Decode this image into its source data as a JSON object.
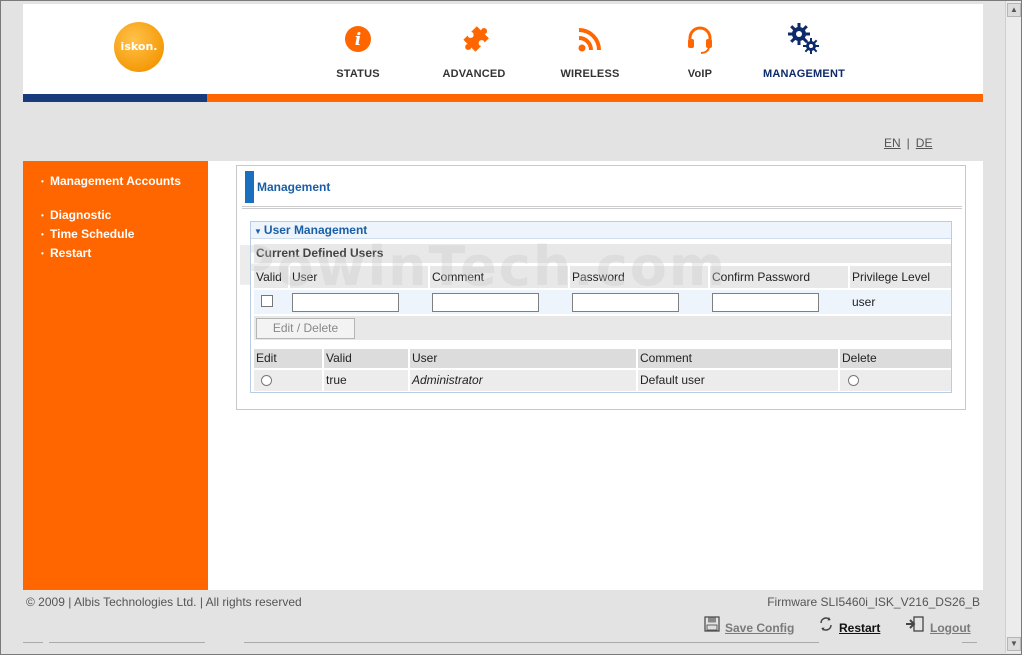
{
  "header": {
    "logo_text": "iskon.",
    "nav": [
      {
        "label": "STATUS",
        "icon": "info-icon"
      },
      {
        "label": "ADVANCED",
        "icon": "puzzle-icon"
      },
      {
        "label": "WIRELESS",
        "icon": "wireless-icon"
      },
      {
        "label": "VoIP",
        "icon": "headset-icon"
      },
      {
        "label": "MANAGEMENT",
        "icon": "gears-icon",
        "active": true
      }
    ]
  },
  "language": {
    "en": "EN",
    "sep": "|",
    "de": "DE"
  },
  "sidebar": {
    "items": [
      {
        "label": "Management Accounts"
      },
      {
        "label": "Diagnostic"
      },
      {
        "label": "Time Schedule"
      },
      {
        "label": "Restart"
      }
    ]
  },
  "panel": {
    "title": "Management",
    "section_title": "User Management",
    "current_users_label": "Current Defined Users",
    "form_headers": [
      "Valid",
      "User",
      "Comment",
      "Password",
      "Confirm Password",
      "Privilege Level"
    ],
    "form_row": {
      "valid_checked": false,
      "user": "",
      "comment": "",
      "password": "",
      "confirm_password": "",
      "privilege_level": "user"
    },
    "edit_delete_label": "Edit / Delete",
    "table_headers": [
      "Edit",
      "Valid",
      "User",
      "Comment",
      "Delete"
    ],
    "table_rows": [
      {
        "valid": "true",
        "user": "Administrator",
        "comment": "Default user"
      }
    ]
  },
  "footer": {
    "copyright": "© 2009 | Albis Technologies Ltd. | All rights reserved",
    "firmware": "Firmware SLI5460i_ISK_V216_DS26_B"
  },
  "actions": {
    "save_config": "Save Config",
    "restart": "Restart",
    "logout": "Logout"
  },
  "watermark": "PowinTech.com",
  "colors": {
    "orange": "#ff6600",
    "blue_bar": "#173b7c",
    "link_blue": "#1a5fa6",
    "logo_orange": "#f59b0a"
  }
}
